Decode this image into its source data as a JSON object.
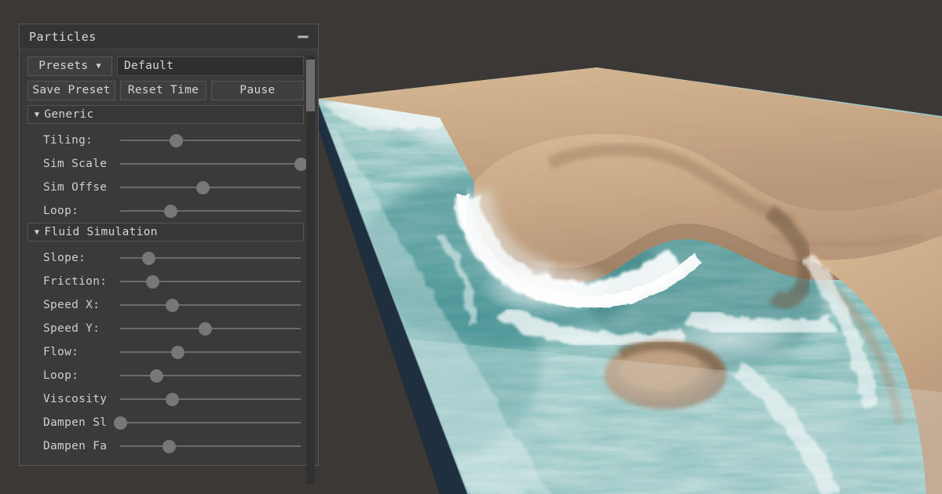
{
  "panel": {
    "title": "Particles",
    "minimize_label": "minimize",
    "toolbar": {
      "presets_label": "Presets",
      "presets_caret": "▼",
      "preset_name_value": "Default",
      "save_preset_label": "Save Preset",
      "reset_time_label": "Reset Time",
      "pause_label": "Pause"
    },
    "sections": [
      {
        "id": "generic",
        "title": "Generic",
        "caret": "▼",
        "expanded": true,
        "sliders": [
          {
            "label": "Tiling:",
            "value": 31
          },
          {
            "label": "Sim Scale",
            "value": 100
          },
          {
            "label": "Sim Offse",
            "value": 46
          },
          {
            "label": "Loop:",
            "value": 28
          }
        ]
      },
      {
        "id": "fluid-simulation",
        "title": "Fluid Simulation",
        "caret": "▼",
        "expanded": true,
        "sliders": [
          {
            "label": "Slope:",
            "value": 16
          },
          {
            "label": "Friction:",
            "value": 18
          },
          {
            "label": "Speed X:",
            "value": 29
          },
          {
            "label": "Speed Y:",
            "value": 47
          },
          {
            "label": "Flow:",
            "value": 32
          },
          {
            "label": "Loop:",
            "value": 20
          },
          {
            "label": "Viscosity",
            "value": 29
          },
          {
            "label": "Dampen Sl",
            "value": 0
          },
          {
            "label": "Dampen Fa",
            "value": 27
          }
        ]
      }
    ],
    "scrollbar": {
      "thumb_top_pct": 1,
      "thumb_height_pct": 12
    }
  },
  "viewport": {
    "scene_name": "fluid-simulation-ocean-terrain",
    "colors": {
      "background": "#3b3836",
      "water_deep": "#2e7a7d",
      "water_mid": "#58a6a4",
      "water_light": "#9ccfca",
      "foam": "#f2f6f5",
      "sand": "#c8a886",
      "sand_shadow": "#8a6f53",
      "terrain_side": "#22384c"
    }
  }
}
